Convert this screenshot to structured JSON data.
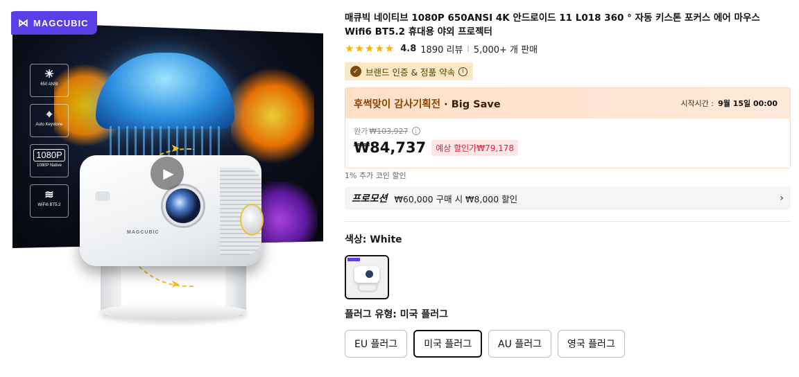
{
  "gallery": {
    "brand_badge": "MAGCUBIC",
    "features": [
      {
        "icon": "sun-icon",
        "glyph": "☀",
        "label": "650 ANSI"
      },
      {
        "icon": "keystone-icon",
        "glyph": "⌖",
        "label": "Auto Keystone"
      },
      {
        "icon": "resolution-icon",
        "glyph": "1080P",
        "label": "1080P Native"
      },
      {
        "icon": "wifi-icon",
        "glyph": "📶",
        "label": "WiFi6 BT5.2"
      }
    ],
    "device_logo": "MAGCUBIC",
    "play_icon": "play-icon"
  },
  "product": {
    "title": "매큐빅 네이티브 1080P 650ANSI 4K 안드로이드 11 L018 360 ° 자동 키스톤 포커스 에어 마우스 Wifi6 BT5.2 휴대용 야외 프로젝터",
    "stars": "★★★★★",
    "rating": "4.8",
    "reviews": "1890 리뷰",
    "sold": "5,000+ 개 판매"
  },
  "trust": {
    "icon": "verified-check-icon",
    "label": "브랜드 인증 & 정품 약속",
    "info_icon": "info-icon"
  },
  "deal": {
    "name_highlight": "후썩맞이 감사기획전",
    "name_suffix": " · Big Save",
    "start_label": "시작시간 :",
    "start_value": "9월 15일 00:00",
    "orig_label": "원가",
    "orig_price": "₩103,927",
    "price": "₩84,737",
    "estimate": "예상 할인가₩79,178"
  },
  "coin_text": "1% 추가 코인 할인",
  "promo": {
    "tag": "프로모션",
    "text": "₩60,000 구매 시 ₩8,000 할인",
    "chevron_icon": "chevron-right-icon"
  },
  "color": {
    "label": "색상: White",
    "options": [
      {
        "name": "White",
        "selected": true
      }
    ]
  },
  "plug": {
    "label": "플러그 유형: 미국 플러그",
    "options": [
      "EU 플러그",
      "미국 플러그",
      "AU 플러그",
      "영국 플러그"
    ],
    "selected_index": 1
  },
  "colors": {
    "brand_purple": "#5b3ee6",
    "star": "#fbb300",
    "deal_bg": "#ffe0c9",
    "discount_red": "#e0233a"
  }
}
